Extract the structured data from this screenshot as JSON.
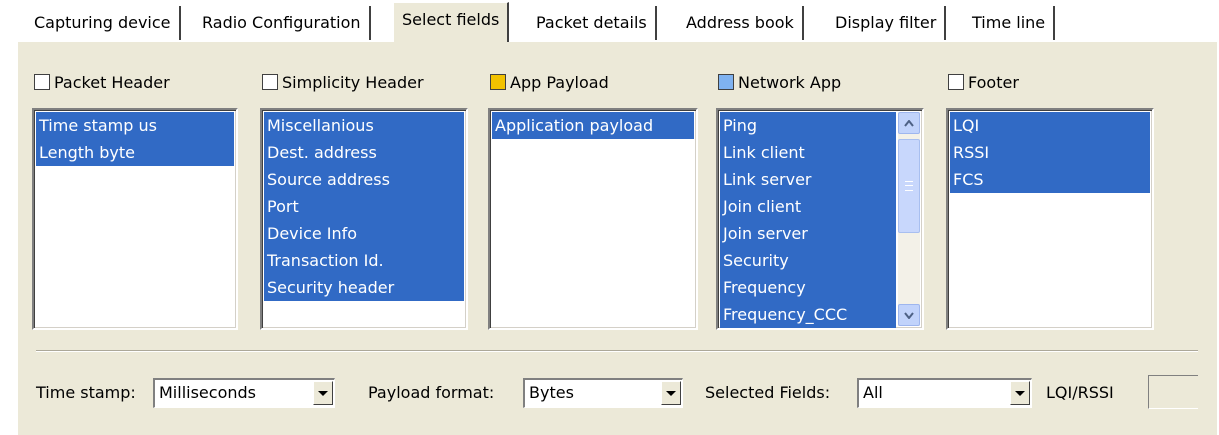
{
  "tabs": [
    {
      "label": "Capturing device",
      "active": false
    },
    {
      "label": "Radio Configuration",
      "active": false
    },
    {
      "label": "Select fields",
      "active": true
    },
    {
      "label": "Packet details",
      "active": false
    },
    {
      "label": "Address book",
      "active": false
    },
    {
      "label": "Display filter",
      "active": false
    },
    {
      "label": "Time line",
      "active": false
    }
  ],
  "groups": [
    {
      "label": "Packet Header",
      "color": "#ffffff",
      "items": [
        "Time stamp us",
        "Length byte"
      ]
    },
    {
      "label": "Simplicity Header",
      "color": "#ffffff",
      "items": [
        "Miscellanious",
        "Dest. address",
        "Source address",
        "Port",
        "Device Info",
        "Transaction Id.",
        "Security header"
      ]
    },
    {
      "label": "App Payload",
      "color": "#f2c200",
      "items": [
        "Application payload"
      ]
    },
    {
      "label": "Network App",
      "color": "#7fb2f0",
      "items": [
        "Ping",
        "Link client",
        "Link server",
        "Join client",
        "Join server",
        "Security",
        "Frequency",
        "Frequency_CCC"
      ]
    },
    {
      "label": "Footer",
      "color": "#ffffff",
      "items": [
        "LQI",
        "RSSI",
        "FCS"
      ]
    }
  ],
  "bottom": {
    "timestamp_label": "Time stamp:",
    "timestamp_value": "Milliseconds",
    "payload_label": "Payload format:",
    "payload_value": "Bytes",
    "selected_label": "Selected Fields:",
    "selected_value": "All",
    "lqi_label": "LQI/RSSI"
  },
  "icons": {
    "scroll_up": "scroll-up-arrow-icon",
    "scroll_down": "scroll-down-arrow-icon",
    "dropdown": "dropdown-arrow-icon"
  }
}
